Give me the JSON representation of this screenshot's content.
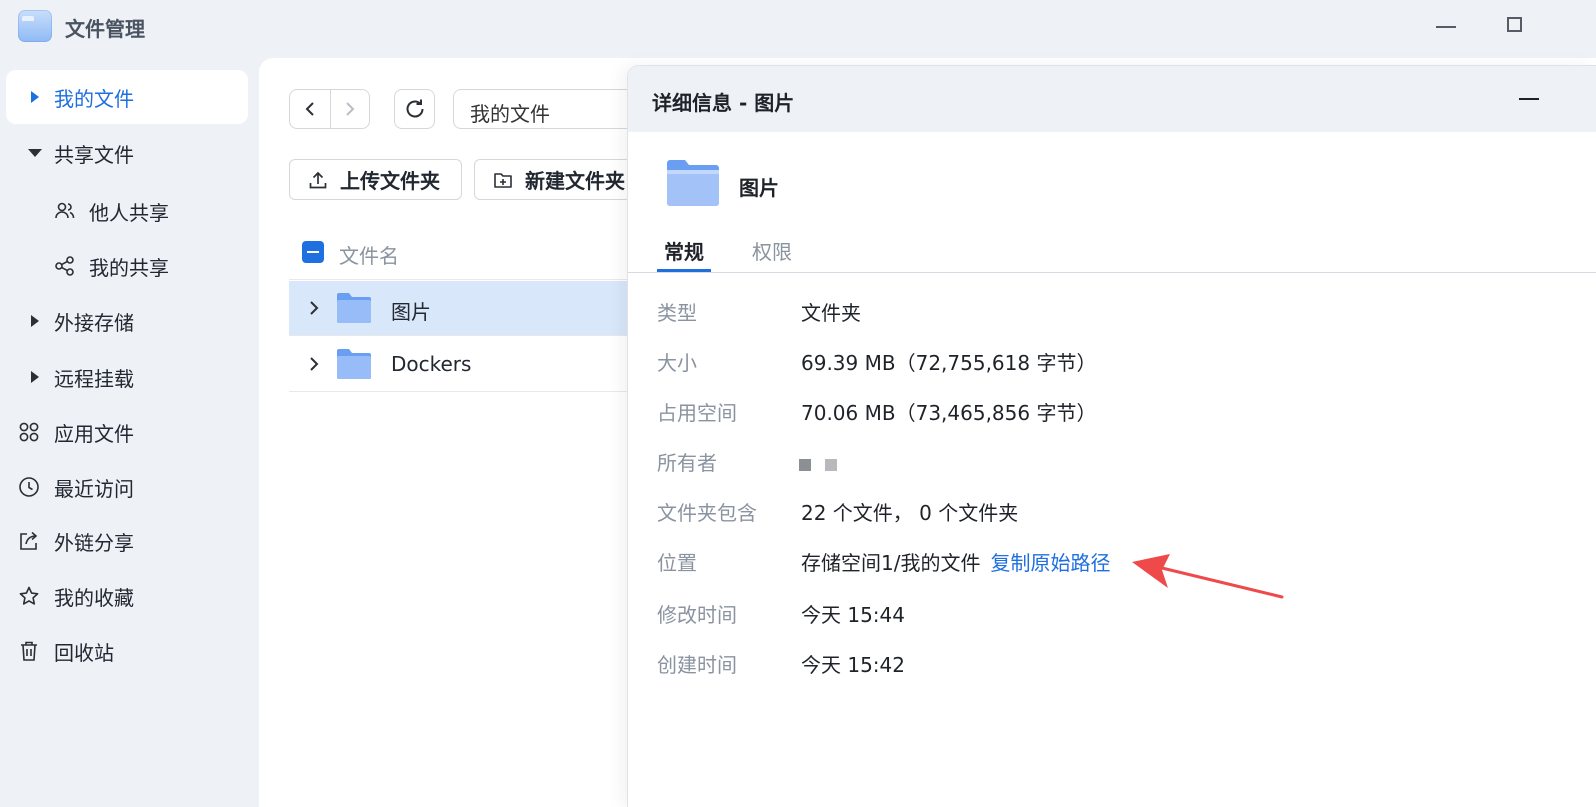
{
  "app": {
    "title": "文件管理"
  },
  "sidebar": {
    "items": [
      {
        "label": "我的文件"
      },
      {
        "label": "共享文件"
      },
      {
        "label": "他人共享"
      },
      {
        "label": "我的共享"
      },
      {
        "label": "外接存储"
      },
      {
        "label": "远程挂载"
      },
      {
        "label": "应用文件"
      },
      {
        "label": "最近访问"
      },
      {
        "label": "外链分享"
      },
      {
        "label": "我的收藏"
      },
      {
        "label": "回收站"
      }
    ]
  },
  "toolbar": {
    "path": "我的文件",
    "upload_label": "上传文件夹",
    "new_folder_label": "新建文件夹"
  },
  "file_list": {
    "header": "文件名",
    "rows": [
      {
        "name": "图片",
        "selected": true
      },
      {
        "name": "Dockers",
        "selected": false
      }
    ]
  },
  "detail": {
    "title": "详细信息 - 图片",
    "name": "图片",
    "tabs": [
      "常规",
      "权限"
    ],
    "fields": {
      "type": {
        "key": "类型",
        "value": "文件夹"
      },
      "size": {
        "key": "大小",
        "value": "69.39 MB（72,755,618 字节）"
      },
      "disk": {
        "key": "占用空间",
        "value": "70.06 MB（73,465,856 字节）"
      },
      "owner": {
        "key": "所有者"
      },
      "contains": {
        "key": "文件夹包含",
        "value": "22 个文件， 0 个文件夹"
      },
      "location": {
        "key": "位置",
        "value": "存储空间1/我的文件",
        "link": "复制原始路径"
      },
      "modified": {
        "key": "修改时间",
        "value": "今天 15:44"
      },
      "created": {
        "key": "创建时间",
        "value": "今天 15:42"
      }
    }
  },
  "colors": {
    "accent": "#1e6fe0",
    "selected_row": "#d9e7fb",
    "annotation_arrow": "#ef4a4a"
  }
}
